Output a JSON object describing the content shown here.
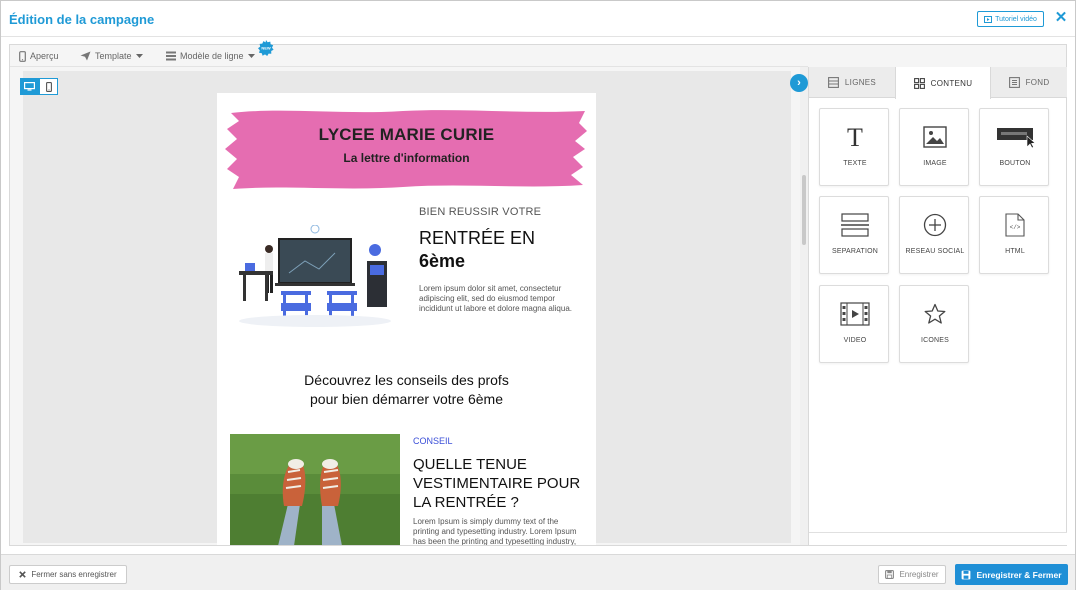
{
  "header": {
    "title": "Édition de la campagne",
    "tutorial_label": "Tutoriel vidéo",
    "close_icon": "close-icon"
  },
  "toolbar": {
    "preview_label": "Aperçu",
    "template_label": "Template",
    "row_model_label": "Modèle de ligne"
  },
  "device_toggle": {
    "desktop_icon": "desktop-icon",
    "mobile_icon": "mobile-icon",
    "active": "desktop"
  },
  "email": {
    "header_title": "LYCEE MARIE CURIE",
    "header_subtitle": "La lettre d'information",
    "article1": {
      "kicker": "BIEN REUSSIR VOTRE",
      "title_line1": "RENTRÉE EN",
      "title_line2": "6ème",
      "body": "Lorem ipsum dolor sit amet, consectetur adipiscing elit, sed do eiusmod tempor incididunt ut labore et dolore magna aliqua."
    },
    "discover_line1": "Découvrez les conseils des profs",
    "discover_line2": "pour bien démarrer votre 6ème",
    "article2": {
      "kicker": "CONSEIL",
      "title": "QUELLE TENUE VESTIMENTAIRE POUR LA RENTRÉE ?",
      "body": "Lorem Ipsum is simply dummy text of the printing and typesetting industry. Lorem Ipsum has been the printing and typesetting industry, text of the"
    },
    "brush_color": "#e56db1"
  },
  "panel": {
    "tabs": [
      {
        "label": "LIGNES",
        "icon": "rows-icon"
      },
      {
        "label": "CONTENU",
        "icon": "grid-icon"
      },
      {
        "label": "FOND",
        "icon": "background-icon"
      }
    ],
    "active_tab": "CONTENU",
    "blocks": [
      {
        "label": "TEXTE",
        "icon": "text-icon"
      },
      {
        "label": "IMAGE",
        "icon": "image-icon"
      },
      {
        "label": "BOUTON",
        "icon": "button-icon"
      },
      {
        "label": "SEPARATION",
        "icon": "divider-icon"
      },
      {
        "label": "RESEAU SOCIAL",
        "icon": "plus-circle-icon"
      },
      {
        "label": "HTML",
        "icon": "html-file-icon"
      },
      {
        "label": "VIDEO",
        "icon": "video-icon"
      },
      {
        "label": "ICONES",
        "icon": "star-icon"
      }
    ]
  },
  "footer": {
    "close_without_save_label": "Fermer sans enregistrer",
    "save_label": "Enregistrer",
    "save_close_label": "Enregistrer & Fermer"
  },
  "colors": {
    "accent": "#1f9ad6",
    "conseil_blue": "#3b4fd8"
  }
}
